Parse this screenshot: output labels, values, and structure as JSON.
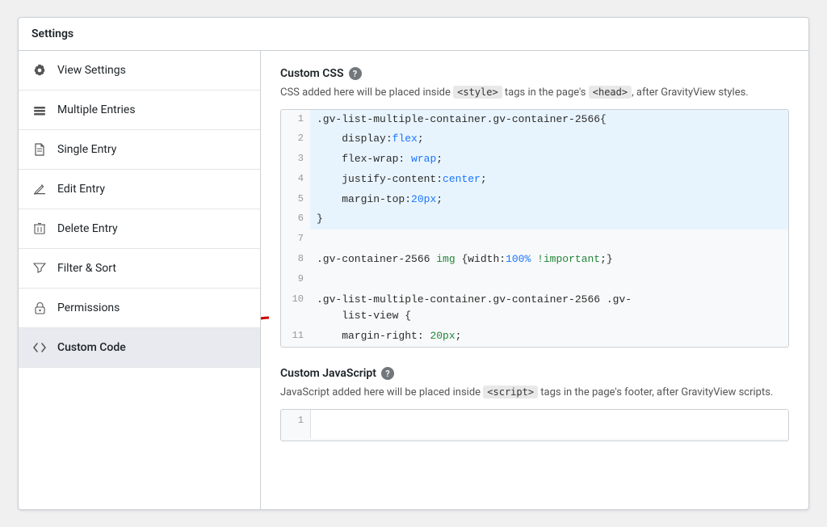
{
  "panel": {
    "title": "Settings"
  },
  "sidebar": {
    "items": [
      {
        "id": "view-settings",
        "label": "View Settings",
        "icon": "gear"
      },
      {
        "id": "multiple-entries",
        "label": "Multiple Entries",
        "icon": "layers"
      },
      {
        "id": "single-entry",
        "label": "Single Entry",
        "icon": "file"
      },
      {
        "id": "edit-entry",
        "label": "Edit Entry",
        "icon": "edit"
      },
      {
        "id": "delete-entry",
        "label": "Delete Entry",
        "icon": "trash"
      },
      {
        "id": "filter-sort",
        "label": "Filter & Sort",
        "icon": "filter"
      },
      {
        "id": "permissions",
        "label": "Permissions",
        "icon": "lock"
      },
      {
        "id": "custom-code",
        "label": "Custom Code",
        "icon": "code",
        "active": true
      }
    ]
  },
  "main": {
    "css_section": {
      "title": "Custom CSS",
      "description_before": "CSS added here will be placed inside ",
      "tag1": "<style>",
      "description_middle": " tags in the page's ",
      "tag2": "<head>",
      "description_after": ", after GravityView styles.",
      "code_lines": [
        {
          "num": 1,
          "content": ".gv-list-multiple-container.gv-container-2566{",
          "highlight": true
        },
        {
          "num": 2,
          "content": "    display:flex;",
          "highlight": true
        },
        {
          "num": 3,
          "content": "    flex-wrap: wrap;",
          "highlight": true
        },
        {
          "num": 4,
          "content": "    justify-content:center;",
          "highlight": true
        },
        {
          "num": 5,
          "content": "    margin-top:20px;",
          "highlight": true
        },
        {
          "num": 6,
          "content": "}",
          "highlight": true
        },
        {
          "num": 7,
          "content": "",
          "highlight": false
        },
        {
          "num": 8,
          "content": ".gv-container-2566 img {width:100% !important;}",
          "highlight": false
        },
        {
          "num": 9,
          "content": "",
          "highlight": false
        },
        {
          "num": 10,
          "content": ".gv-list-multiple-container.gv-container-2566 .gv-list-view {",
          "highlight": false
        },
        {
          "num": 11,
          "content": "    margin-right: 20px;",
          "highlight": false
        }
      ]
    },
    "js_section": {
      "title": "Custom JavaScript",
      "description_before": "JavaScript added here will be placed inside ",
      "tag1": "<script>",
      "description_after": " tags in the page's footer, after GravityView scripts.",
      "code_lines": [
        {
          "num": 1,
          "content": ""
        }
      ]
    }
  }
}
